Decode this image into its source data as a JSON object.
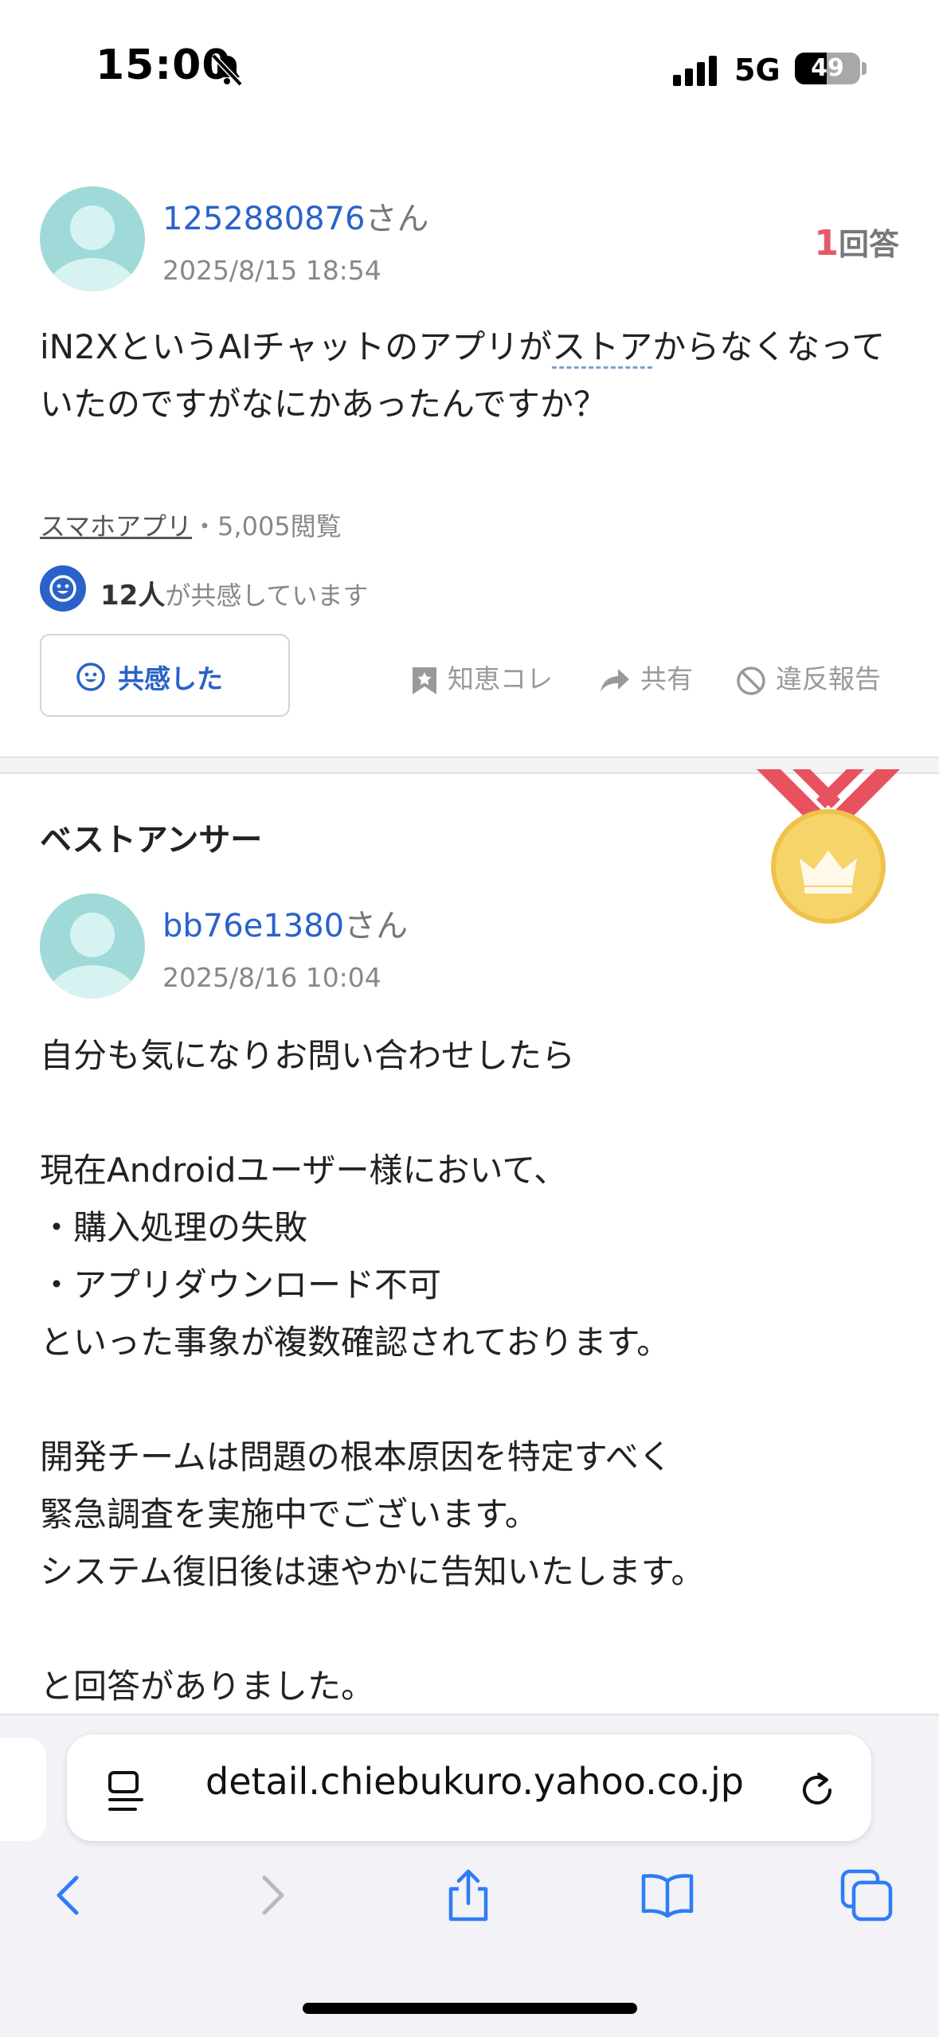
{
  "status_bar": {
    "time": "15:00",
    "network": "5G",
    "battery_level": "49",
    "battery_fraction": 0.49
  },
  "question": {
    "user_name": "1252880876",
    "user_suffix": "さん",
    "date": "2025/8/15 18:54",
    "answers_count": "1",
    "answers_label": "回答",
    "text_before": "iN2XというAIチャットのアプリが",
    "text_linked": "ストア",
    "text_after": "からなくなっていたのですがなにかあったんですか？",
    "category": "スマホアプリ",
    "views": "・5,005閲覧",
    "empathy_count": "12人",
    "empathy_text": "が共感しています",
    "empathy_button": "共感した",
    "actions": {
      "bookmark": "知恵コレ",
      "share": "共有",
      "report": "違反報告"
    }
  },
  "best_answer": {
    "title": "ベストアンサー",
    "user_name": "bb76e1380",
    "user_suffix": "さん",
    "date": "2025/8/16 10:04",
    "body": "自分も気になりお問い合わせしたら\n\n現在Androidユーザー様において、\n・購入処理の失敗\n・アプリダウンロード不可\nといった事象が複数確認されております。\n\n開発チームは問題の根本原因を特定すべく\n緊急調査を実施中でございます。\nシステム復旧後は速やかに告知いたします。\n\nと回答がありました。"
  },
  "browser": {
    "url": "detail.chiebukuro.yahoo.co.jp"
  },
  "colors": {
    "link_blue": "#2a62c9",
    "answer_count_red": "#e45a6a",
    "avatar_teal": "#9fdad8",
    "medal_gold": "#f5c84c",
    "ribbon_red": "#e8525e",
    "safari_blue": "#2f7cf6"
  }
}
